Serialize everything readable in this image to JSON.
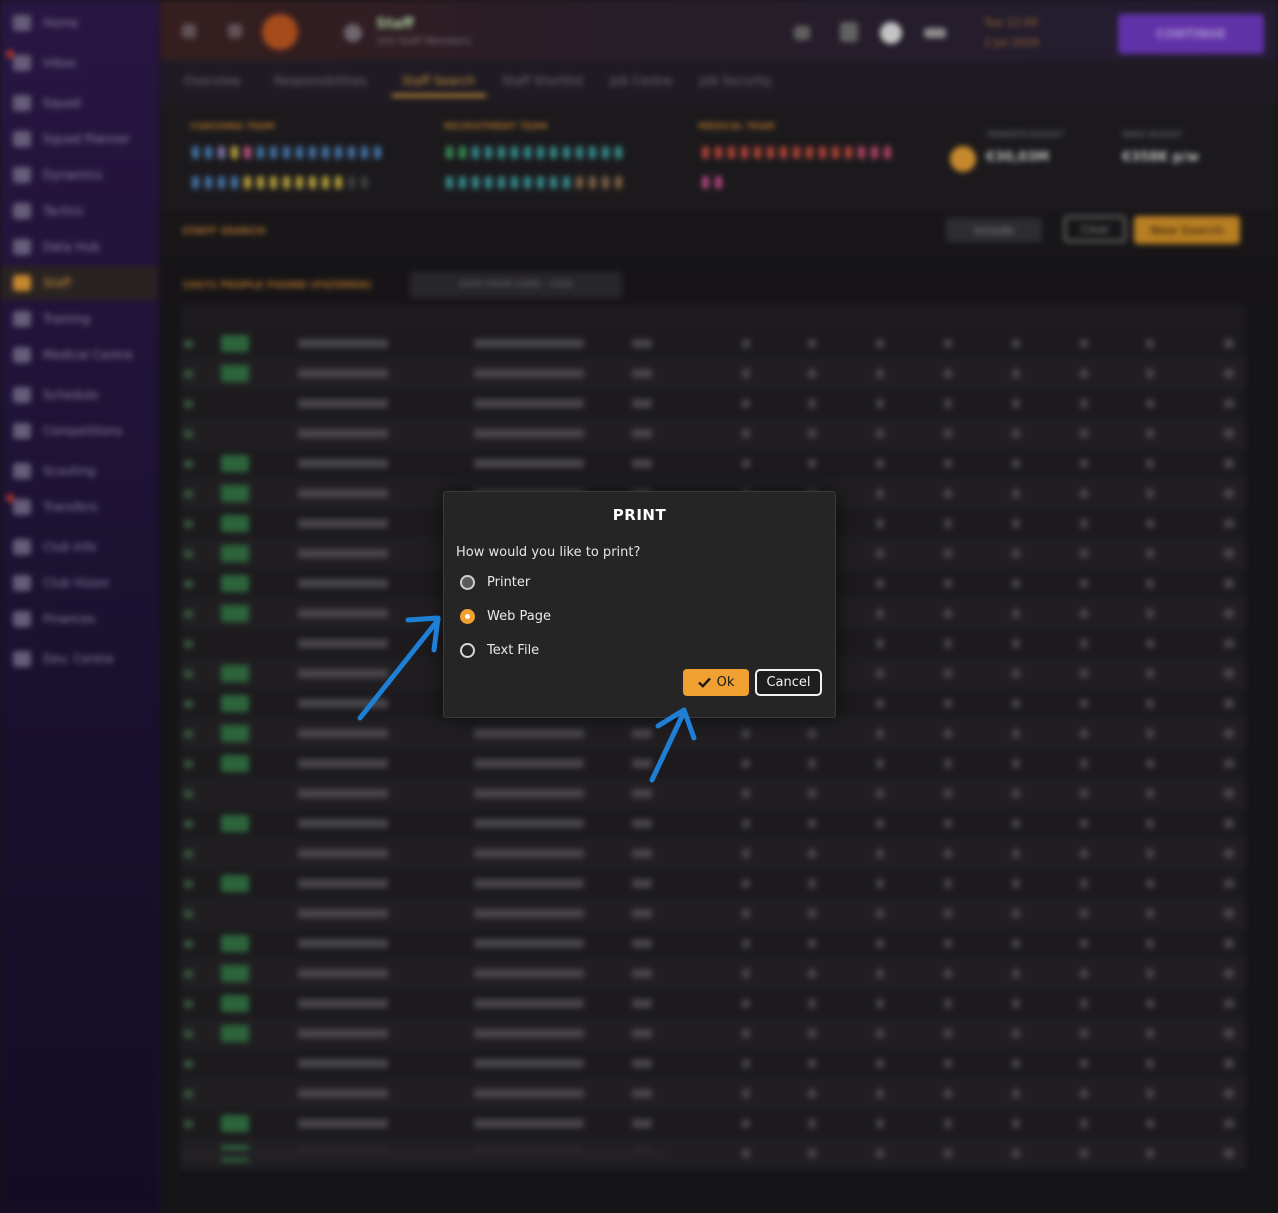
{
  "window": {
    "title": "Staff",
    "subtitle": "193 Staff Members"
  },
  "sidebar": {
    "items": [
      {
        "label": "Home",
        "icon": "home-icon"
      },
      {
        "label": "Inbox",
        "icon": "inbox-icon"
      },
      {
        "label": "Squad",
        "icon": "squad-icon"
      },
      {
        "label": "Squad Planner",
        "icon": "planner-icon"
      },
      {
        "label": "Dynamics",
        "icon": "dynamics-icon"
      },
      {
        "label": "Tactics",
        "icon": "tactics-icon"
      },
      {
        "label": "Data Hub",
        "icon": "data-hub-icon"
      },
      {
        "label": "Staff",
        "icon": "staff-icon"
      },
      {
        "label": "Training",
        "icon": "training-icon"
      },
      {
        "label": "Medical Centre",
        "icon": "medical-icon"
      },
      {
        "label": "Schedule",
        "icon": "schedule-icon"
      },
      {
        "label": "Competitions",
        "icon": "trophy-icon"
      },
      {
        "label": "Scouting",
        "icon": "scouting-icon"
      },
      {
        "label": "Transfers",
        "icon": "transfers-icon"
      },
      {
        "label": "Club Info",
        "icon": "club-info-icon"
      },
      {
        "label": "Club Vision",
        "icon": "club-vision-icon"
      },
      {
        "label": "Finances",
        "icon": "finances-icon"
      },
      {
        "label": "Dev. Centre",
        "icon": "dev-centre-icon"
      }
    ]
  },
  "topbar": {
    "date_line1": "Tue 12:00",
    "date_line2": "2 Jul 2024",
    "continue_label": "CONTINUE"
  },
  "subnav": {
    "tabs": [
      "Overview",
      "Responsibilities",
      "Staff Search",
      "Staff Shortlist",
      "Job Centre",
      "Job Security"
    ],
    "active": "Staff Search"
  },
  "teams": {
    "coaching": "COACHING TEAM",
    "recruitment": "RECRUITMENT TEAM",
    "medical": "MEDICAL TEAM",
    "transfer_budget_label": "TRANSFER BUDGET",
    "transfer_budget_value": "€30,03M",
    "wage_budget_label": "WAGE BUDGET",
    "wage_budget_value": "€358K p/w"
  },
  "search": {
    "title": "STAFF SEARCH",
    "include_label": "Include",
    "clear_label": "Clear",
    "new_search_label": "New Search"
  },
  "results": {
    "title": "19472 PEOPLE FOUND (FILTERED)",
    "source_label": "DATA FROM GAME - 2026"
  },
  "dialog": {
    "title": "PRINT",
    "prompt": "How would you like to print?",
    "options": [
      "Printer",
      "Web Page",
      "Text File"
    ],
    "selected": "Web Page",
    "ok_label": "Ok",
    "cancel_label": "Cancel"
  },
  "colors": {
    "accent": "#f0a030",
    "annotation_arrow": "#1e7fd6",
    "sidebar": "#1d1236",
    "dialog_bg": "#252525"
  }
}
